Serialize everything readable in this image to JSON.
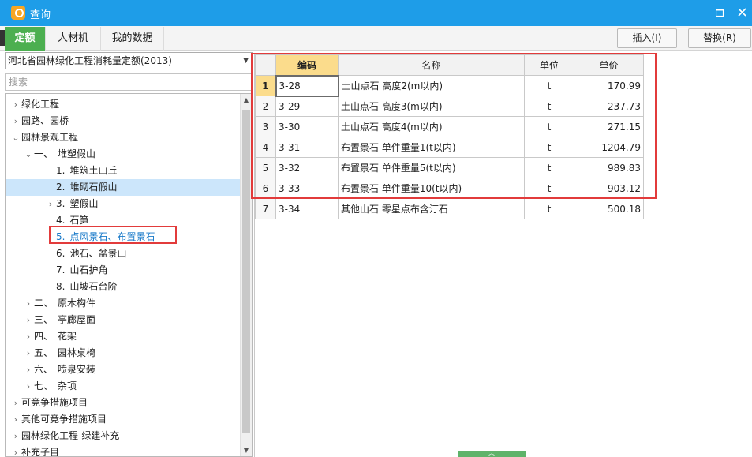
{
  "window": {
    "title": "查询",
    "maximize_glyph": "▫",
    "close_glyph": "✕"
  },
  "tabs": [
    {
      "label": "定额",
      "active": true
    },
    {
      "label": "人材机",
      "active": false
    },
    {
      "label": "我的数据",
      "active": false
    }
  ],
  "actions": {
    "insert_label": "插入(I)",
    "replace_label": "替换(R)"
  },
  "library": {
    "selected": "河北省园林绿化工程消耗量定额(2013)"
  },
  "search": {
    "placeholder": "搜索"
  },
  "tree": {
    "items": [
      {
        "label": "绿化工程",
        "chevron": "›",
        "num": ""
      },
      {
        "label": "园路、园桥",
        "chevron": "›",
        "num": ""
      },
      {
        "label": "园林景观工程",
        "chevron": "⌄",
        "num": ""
      },
      {
        "label": "堆塑假山",
        "chevron": "⌄",
        "num": "一、"
      },
      {
        "label": "堆筑土山丘",
        "chevron": "",
        "num": "1."
      },
      {
        "label": "堆砌石假山",
        "chevron": "",
        "num": "2."
      },
      {
        "label": "塑假山",
        "chevron": "›",
        "num": "3."
      },
      {
        "label": "石笋",
        "chevron": "",
        "num": "4."
      },
      {
        "label": "点风景石、布置景石",
        "chevron": "",
        "num": "5."
      },
      {
        "label": "池石、盆景山",
        "chevron": "",
        "num": "6."
      },
      {
        "label": "山石护角",
        "chevron": "",
        "num": "7."
      },
      {
        "label": "山坡石台阶",
        "chevron": "",
        "num": "8."
      },
      {
        "label": "原木构件",
        "chevron": "›",
        "num": "二、"
      },
      {
        "label": "亭廊屋面",
        "chevron": "›",
        "num": "三、"
      },
      {
        "label": "花架",
        "chevron": "›",
        "num": "四、"
      },
      {
        "label": "园林桌椅",
        "chevron": "›",
        "num": "五、"
      },
      {
        "label": "喷泉安装",
        "chevron": "›",
        "num": "六、"
      },
      {
        "label": "杂项",
        "chevron": "›",
        "num": "七、"
      },
      {
        "label": "可竞争措施项目",
        "chevron": "›",
        "num": ""
      },
      {
        "label": "其他可竞争措施项目",
        "chevron": "›",
        "num": ""
      },
      {
        "label": "园林绿化工程-绿建补充",
        "chevron": "›",
        "num": ""
      },
      {
        "label": "补充子目",
        "chevron": "›",
        "num": ""
      }
    ]
  },
  "grid": {
    "columns": [
      "编码",
      "名称",
      "单位",
      "单价"
    ],
    "rows": [
      {
        "no": "1",
        "code": "3-28",
        "name": "土山点石 高度2(m以内)",
        "unit": "t",
        "price": "170.99"
      },
      {
        "no": "2",
        "code": "3-29",
        "name": "土山点石 高度3(m以内)",
        "unit": "t",
        "price": "237.73"
      },
      {
        "no": "3",
        "code": "3-30",
        "name": "土山点石 高度4(m以内)",
        "unit": "t",
        "price": "271.15"
      },
      {
        "no": "4",
        "code": "3-31",
        "name": "布置景石 单件重量1(t以内)",
        "unit": "t",
        "price": "1204.79"
      },
      {
        "no": "5",
        "code": "3-32",
        "name": "布置景石 单件重量5(t以内)",
        "unit": "t",
        "price": "989.83"
      },
      {
        "no": "6",
        "code": "3-33",
        "name": "布置景石 单件重量10(t以内)",
        "unit": "t",
        "price": "903.12"
      },
      {
        "no": "7",
        "code": "3-34",
        "name": "其他山石 零星点布含汀石",
        "unit": "t",
        "price": "500.18"
      }
    ]
  },
  "colors": {
    "titlebar": "#1e9de8",
    "active_tab": "#4caf50",
    "highlight": "#e23b3b",
    "selected_row": "#cce6fb"
  }
}
